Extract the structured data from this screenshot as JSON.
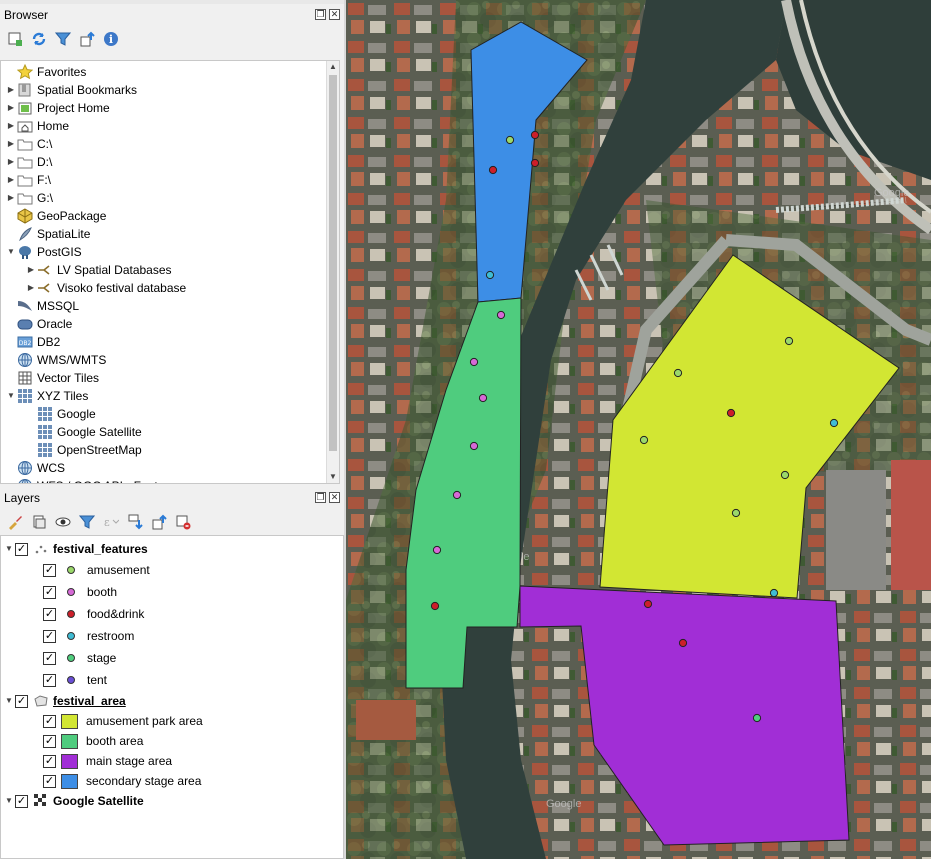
{
  "browser": {
    "title": "Browser",
    "items": [
      {
        "label": "Favorites",
        "icon": "star-icon",
        "arrow": false,
        "indent": 0
      },
      {
        "label": "Spatial Bookmarks",
        "icon": "bookmark-icon",
        "arrow": true,
        "indent": 0
      },
      {
        "label": "Project Home",
        "icon": "project-home-icon",
        "arrow": true,
        "indent": 0
      },
      {
        "label": "Home",
        "icon": "home-folder-icon",
        "arrow": true,
        "indent": 0
      },
      {
        "label": "C:\\",
        "icon": "drive-folder-icon",
        "arrow": true,
        "indent": 0
      },
      {
        "label": "D:\\",
        "icon": "drive-folder-icon",
        "arrow": true,
        "indent": 0
      },
      {
        "label": "F:\\",
        "icon": "drive-folder-icon",
        "arrow": true,
        "indent": 0
      },
      {
        "label": "G:\\",
        "icon": "drive-folder-icon",
        "arrow": true,
        "indent": 0
      },
      {
        "label": "GeoPackage",
        "icon": "geopackage-icon",
        "arrow": false,
        "indent": 0
      },
      {
        "label": "SpatiaLite",
        "icon": "spatialite-icon",
        "arrow": false,
        "indent": 0
      },
      {
        "label": "PostGIS",
        "icon": "postgis-elephant-icon",
        "arrow": "open",
        "indent": 0
      },
      {
        "label": "LV Spatial Databases",
        "icon": "connection-icon",
        "arrow": true,
        "indent": 1
      },
      {
        "label": "Visoko festival database",
        "icon": "connection-icon",
        "arrow": true,
        "indent": 1
      },
      {
        "label": "MSSQL",
        "icon": "mssql-icon",
        "arrow": false,
        "indent": 0
      },
      {
        "label": "Oracle",
        "icon": "oracle-icon",
        "arrow": false,
        "indent": 0
      },
      {
        "label": "DB2",
        "icon": "db2-icon",
        "arrow": false,
        "indent": 0
      },
      {
        "label": "WMS/WMTS",
        "icon": "globe-icon",
        "arrow": false,
        "indent": 0
      },
      {
        "label": "Vector Tiles",
        "icon": "grid-icon",
        "arrow": false,
        "indent": 0
      },
      {
        "label": "XYZ Tiles",
        "icon": "tiles-icon",
        "arrow": "open",
        "indent": 0
      },
      {
        "label": "Google",
        "icon": "tiles-icon",
        "arrow": false,
        "indent": 1
      },
      {
        "label": "Google Satellite",
        "icon": "tiles-icon",
        "arrow": false,
        "indent": 1
      },
      {
        "label": "OpenStreetMap",
        "icon": "tiles-icon",
        "arrow": false,
        "indent": 1
      },
      {
        "label": "WCS",
        "icon": "globe-icon",
        "arrow": false,
        "indent": 0
      },
      {
        "label": "WFS / OGC API - Features",
        "icon": "globe-icon",
        "arrow": false,
        "indent": 0
      }
    ]
  },
  "layers": {
    "title": "Layers",
    "groups": [
      {
        "label": "festival_features",
        "underline": false,
        "type": "point",
        "children": [
          {
            "label": "amusement",
            "color": "#9bd86a"
          },
          {
            "label": "booth",
            "color": "#d669d6"
          },
          {
            "label": "food&drink",
            "color": "#cc1f2a"
          },
          {
            "label": "restroom",
            "color": "#3fbcd4"
          },
          {
            "label": "stage",
            "color": "#4fcf7e"
          },
          {
            "label": "tent",
            "color": "#6a4fd6"
          }
        ]
      },
      {
        "label": "festival_area",
        "underline": true,
        "type": "polygon",
        "children": [
          {
            "label": "amusement park area",
            "color": "#d2e633"
          },
          {
            "label": "booth area",
            "color": "#4fcc7e"
          },
          {
            "label": "main stage area",
            "color": "#a12ed6"
          },
          {
            "label": "secondary stage area",
            "color": "#3d8ee6"
          }
        ]
      },
      {
        "label": "Google Satellite",
        "underline": false,
        "type": "raster",
        "children": []
      }
    ]
  },
  "map": {
    "watermark": "Google",
    "polygons": [
      {
        "name": "secondary-stage-area",
        "color": "#3d8ee6"
      },
      {
        "name": "booth-area",
        "color": "#4fcc7e"
      },
      {
        "name": "amusement-park-area",
        "color": "#d2e633"
      },
      {
        "name": "main-stage-area",
        "color": "#a12ed6"
      }
    ]
  }
}
